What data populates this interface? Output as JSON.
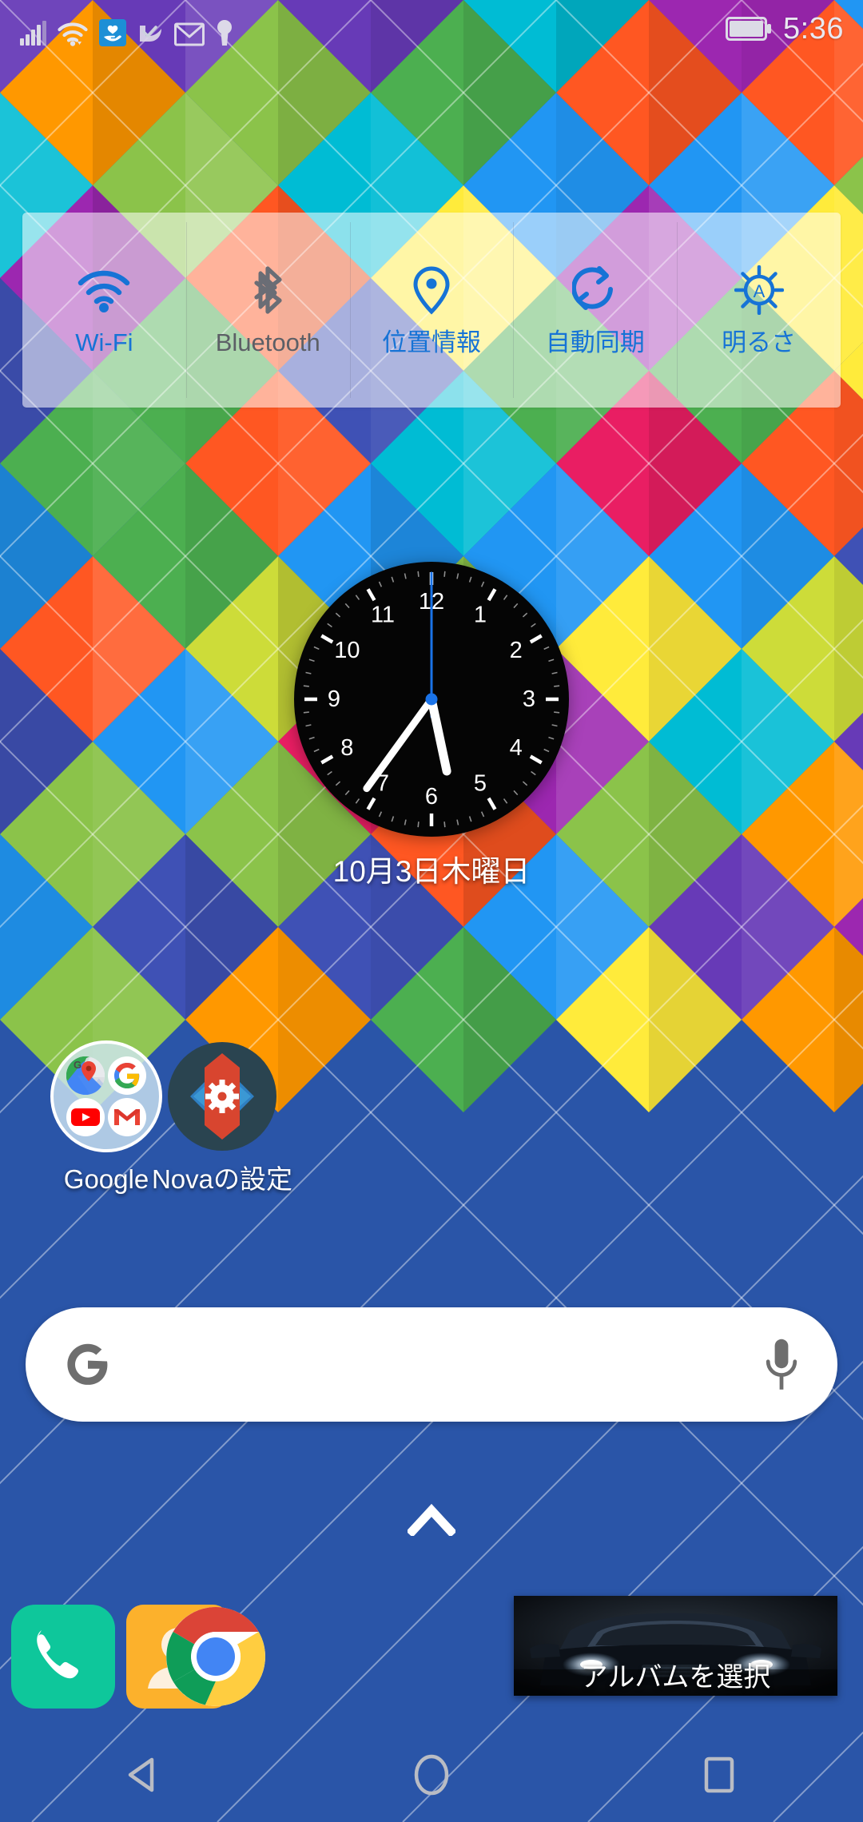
{
  "status_bar": {
    "time": "5:36",
    "battery_icon": "battery-full-icon",
    "left_icons": [
      {
        "name": "cellular-signal-icon",
        "label": "signal"
      },
      {
        "name": "wifi-icon",
        "label": "wifi"
      },
      {
        "name": "heart-in-hand-app-icon",
        "label": "health app notification"
      },
      {
        "name": "check-swoosh-icon",
        "label": "task notification"
      },
      {
        "name": "email-envelope-icon",
        "label": "email"
      },
      {
        "name": "keyhole-person-icon",
        "label": "account"
      }
    ]
  },
  "quick_settings": {
    "tiles": [
      {
        "label": "Wi-Fi",
        "icon": "wifi-icon",
        "state": "on"
      },
      {
        "label": "Bluetooth",
        "icon": "bluetooth-icon",
        "state": "off"
      },
      {
        "label": "位置情報",
        "icon": "location-pin-icon",
        "state": "on"
      },
      {
        "label": "自動同期",
        "icon": "sync-icon",
        "state": "on"
      },
      {
        "label": "明るさ",
        "icon": "brightness-auto-icon",
        "state": "on"
      }
    ],
    "on_color": "#1673d6",
    "off_color": "#5c5f66"
  },
  "clock_widget": {
    "type": "analog",
    "hours": [
      "12",
      "1",
      "2",
      "3",
      "4",
      "5",
      "6",
      "7",
      "8",
      "9",
      "10",
      "11"
    ],
    "hour_hand_deg": 168,
    "minute_hand_deg": 216,
    "second_hand_deg": 0,
    "face_color": "#050505",
    "hand_color": "#ffffff",
    "second_hand_color": "#1a73e8",
    "date": "10月3日木曜日"
  },
  "home_apps": [
    {
      "name": "google-folder",
      "label": "Google",
      "icon": "google-folder-icon",
      "contents": [
        "maps-icon",
        "google-g-icon",
        "youtube-icon",
        "gmail-icon"
      ]
    },
    {
      "name": "nova-settings",
      "label": "Novaの設定",
      "icon": "nova-settings-icon"
    }
  ],
  "search": {
    "placeholder": "",
    "value": "",
    "left_icon": "google-g-icon",
    "right_icon": "microphone-icon",
    "background": "#ffffff"
  },
  "drawer": {
    "chevron_icon": "chevron-up-icon"
  },
  "dock": [
    {
      "name": "phone",
      "icon": "phone-icon",
      "color": "#0ec79b"
    },
    {
      "name": "contacts",
      "icon": "contacts-person-icon",
      "color": "#f9a825"
    },
    {
      "name": "chrome",
      "icon": "chrome-icon",
      "color": "#4285f4"
    }
  ],
  "album_widget": {
    "label": "アルバムを選択",
    "image": "dark-car-photo"
  },
  "nav_bar": {
    "back": {
      "label": "back",
      "icon": "back-triangle-icon"
    },
    "home": {
      "label": "home",
      "icon": "home-circle-icon"
    },
    "recents": {
      "label": "recents",
      "icon": "recents-square-icon"
    },
    "color": "#b9bcc4"
  },
  "wallpaper": {
    "style": "diamond-lattice",
    "colors": [
      "#3f51b5",
      "#2196f3",
      "#00bcd4",
      "#4caf50",
      "#8bc34a",
      "#cddc39",
      "#ffeb3b",
      "#ff9800",
      "#ff5722",
      "#e91e63",
      "#9c27b0",
      "#673ab7"
    ]
  }
}
